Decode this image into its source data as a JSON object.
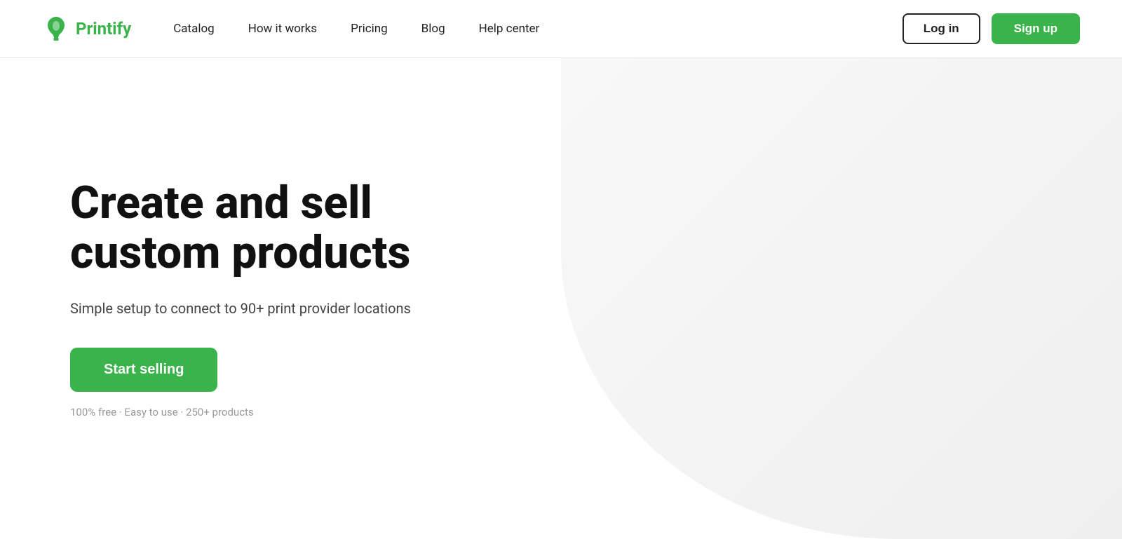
{
  "brand": {
    "name": "Printify",
    "logo_alt": "Printify logo"
  },
  "nav": {
    "links": [
      {
        "label": "Catalog",
        "id": "catalog"
      },
      {
        "label": "How it works",
        "id": "how-it-works"
      },
      {
        "label": "Pricing",
        "id": "pricing"
      },
      {
        "label": "Blog",
        "id": "blog"
      },
      {
        "label": "Help center",
        "id": "help-center"
      }
    ],
    "login_label": "Log in",
    "signup_label": "Sign up"
  },
  "hero": {
    "title_line1": "Create and sell",
    "title_line2": "custom products",
    "subtitle": "Simple setup to connect to 90+ print provider locations",
    "cta_label": "Start selling",
    "footnote": "100% free · Easy to use · 250+ products"
  }
}
